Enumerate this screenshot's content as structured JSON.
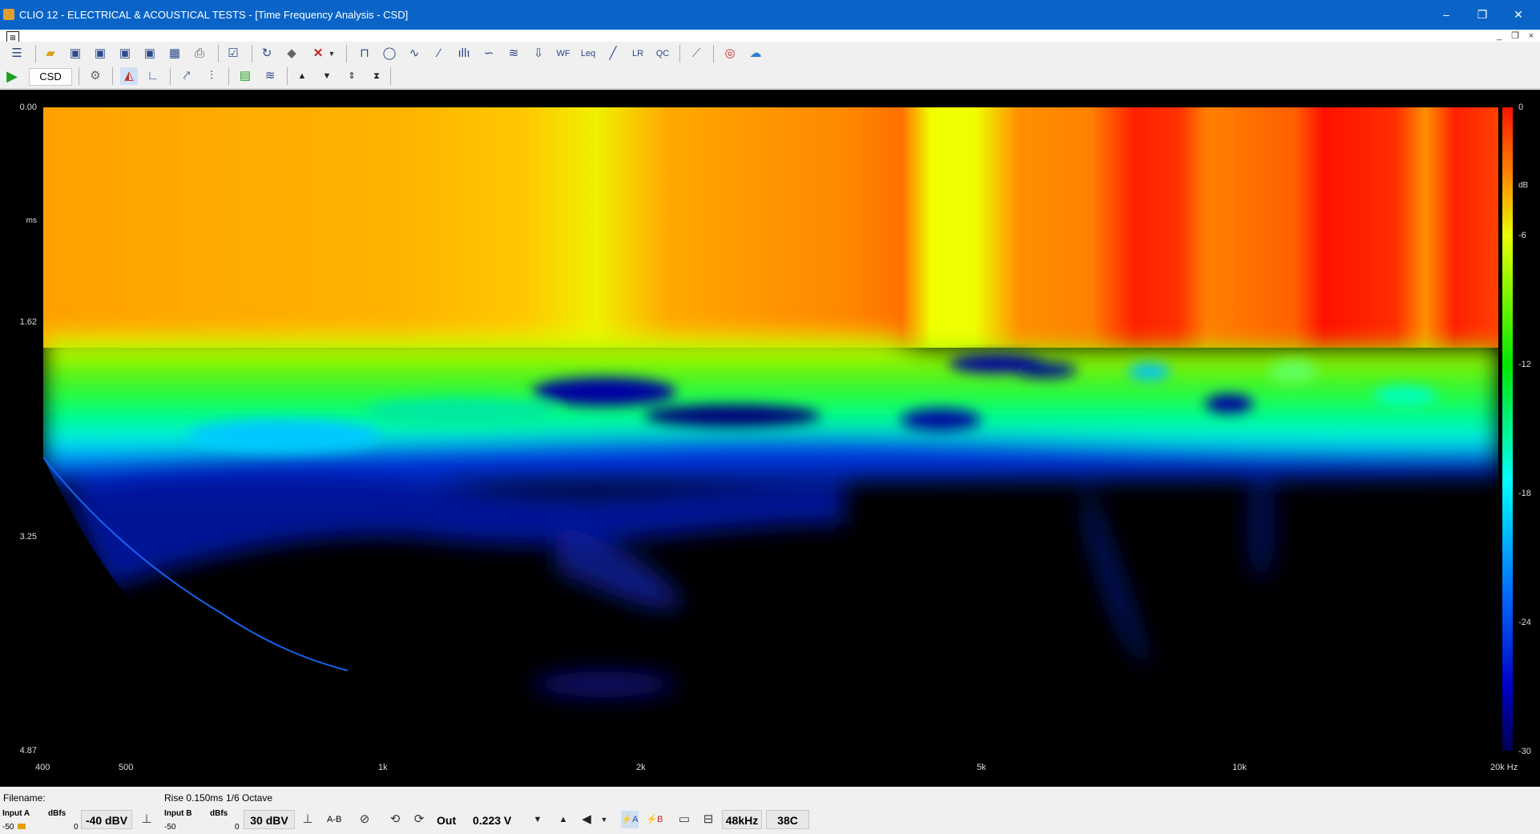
{
  "window": {
    "title": "CLIO 12 - ELECTRICAL & ACOUSTICAL TESTS - [Time Frequency Analysis - CSD]",
    "minimize": "–",
    "restore": "❐",
    "close": "✕"
  },
  "toolbar2": {
    "mode_label": "CSD"
  },
  "plot": {
    "y_ticks": [
      "0.00",
      "ms",
      "1.62",
      "3.25",
      "4.87"
    ],
    "x_ticks": [
      "400",
      "500",
      "1k",
      "2k",
      "5k",
      "10k",
      "20k Hz"
    ],
    "colorbar_ticks": [
      "0",
      "dB",
      "-6",
      "-12",
      "-18",
      "-24",
      "-30"
    ]
  },
  "status": {
    "filename_label": "Filename:",
    "rise": "Rise 0.150ms",
    "smoothing": "1/6 Octave",
    "input_a_label": "Input A",
    "input_a_units": "dBfs",
    "input_a_scale_min": "-50",
    "input_a_scale_max": "0",
    "input_a_level": "-40 dBV",
    "input_b_label": "Input B",
    "input_b_units": "dBfs",
    "input_b_scale_min": "-50",
    "input_b_scale_max": "0",
    "input_b_level": "30 dBV",
    "ab_label": "A-B",
    "out_label": "Out",
    "out_value": "0.223 V",
    "sample_rate": "48kHz",
    "temperature": "38C"
  },
  "colors": {
    "titlebar": "#0a64c8",
    "plot_bg": "#000000"
  }
}
